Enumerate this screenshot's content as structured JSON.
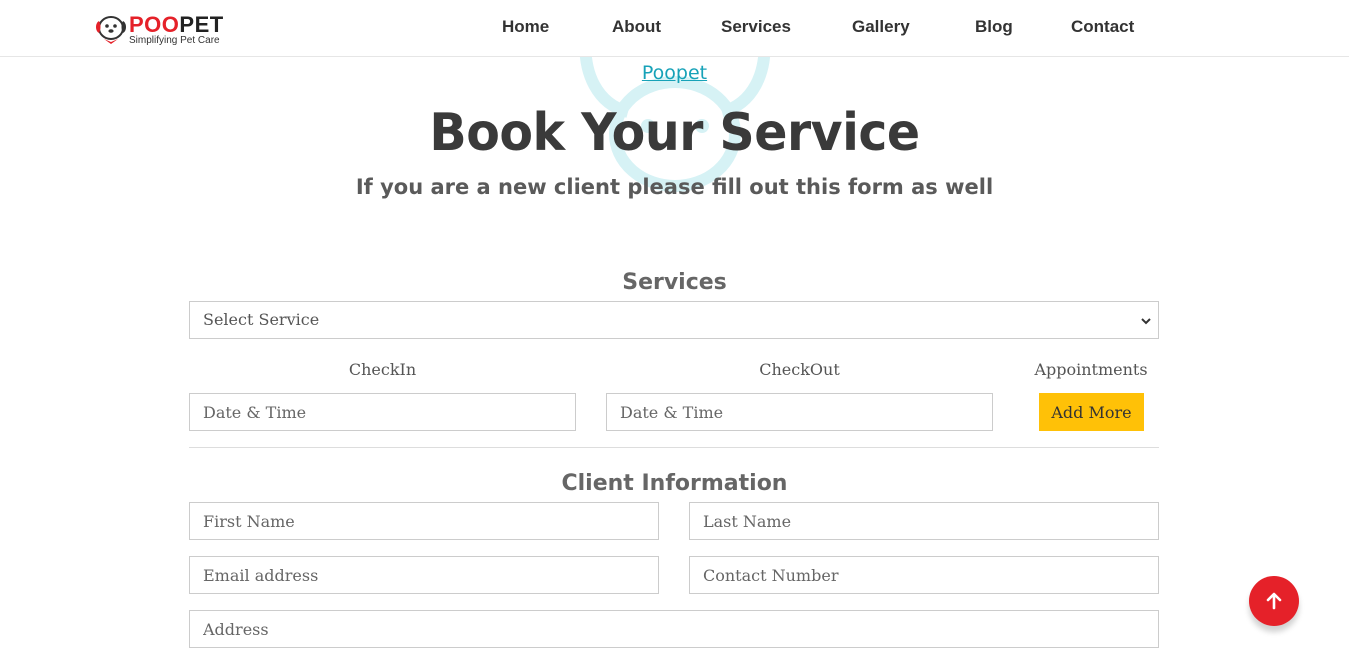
{
  "header": {
    "brand": {
      "name_part1": "POO",
      "name_part2": "PET",
      "tagline": "Simplifying Pet Care"
    },
    "nav": [
      {
        "label": "Home"
      },
      {
        "label": "About"
      },
      {
        "label": "Services"
      },
      {
        "label": "Gallery"
      },
      {
        "label": "Blog"
      },
      {
        "label": "Contact"
      }
    ]
  },
  "hero": {
    "kicker": "Poopet",
    "title": "Book Your Service",
    "subtitle": "If you are a new client please fill out this form as well",
    "watermark_icon": "paw-icon"
  },
  "services_section": {
    "heading": "Services",
    "service_select": {
      "selected": "Select Service"
    },
    "checkin": {
      "label": "CheckIn",
      "placeholder": "Date & Time"
    },
    "checkout": {
      "label": "CheckOut",
      "placeholder": "Date & Time"
    },
    "appointments": {
      "label": "Appointments",
      "button": "Add More"
    }
  },
  "client_section": {
    "heading": "Client Information",
    "first_name": {
      "placeholder": "First Name"
    },
    "last_name": {
      "placeholder": "Last Name"
    },
    "email": {
      "placeholder": "Email address"
    },
    "contact": {
      "placeholder": "Contact Number"
    },
    "address": {
      "placeholder": "Address"
    }
  },
  "back_to_top": {
    "icon": "arrow-up-icon"
  },
  "colors": {
    "brand_red": "#e52129",
    "accent_teal": "#17a2b8",
    "button_yellow": "#ffc107",
    "heading_dark": "#3a3a3a"
  }
}
